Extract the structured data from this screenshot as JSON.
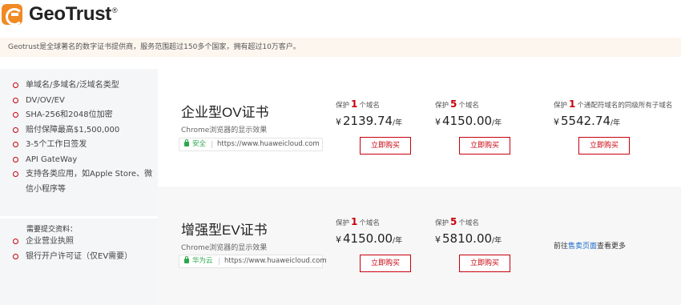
{
  "brand": {
    "name": "GeoTrust",
    "reg": "®"
  },
  "banner": "Geotrust是全球著名的数字证书提供商，服务范围超过150多个国家，拥有超过10万客户。",
  "features": [
    "单域名/多域名/泛域名类型",
    "DV/OV/EV",
    "SHA-256和2048位加密",
    "赔付保障最高$1,500,000",
    "3-5个工作日签发",
    "API GateWay",
    "支持各类应用，如Apple Store、微信小程序等"
  ],
  "requirements": {
    "title": "需要提交资料：",
    "items": [
      "企业营业执照",
      "银行开户许可证（仅EV需要）"
    ]
  },
  "ov": {
    "title": "企业型OV证书",
    "browser_label": "Chrome浏览器的显示效果",
    "badge": "安全",
    "url": "https://www.huaweicloud.com",
    "options": [
      {
        "prefix": "保护",
        "count": "1",
        "suffix": "个域名",
        "currency": "¥",
        "price": "2139.74",
        "unit": "/年",
        "button": "立即购买"
      },
      {
        "prefix": "保护",
        "count": "5",
        "suffix": "个域名",
        "currency": "¥",
        "price": "4150.00",
        "unit": "/年",
        "button": "立即购买"
      },
      {
        "prefix": "保护",
        "count": "1",
        "suffix": "个通配符域名的同级所有子域名",
        "currency": "¥",
        "price": "5542.74",
        "unit": "/年",
        "button": "立即购买"
      }
    ]
  },
  "ev": {
    "title": "增强型EV证书",
    "browser_label": "Chrome浏览器的显示效果",
    "badge": "华为云",
    "url": "https://www.huaweicloud.com",
    "options": [
      {
        "prefix": "保护",
        "count": "1",
        "suffix": "个域名",
        "currency": "¥",
        "price": "4150.00",
        "unit": "/年",
        "button": "立即购买"
      },
      {
        "prefix": "保护",
        "count": "5",
        "suffix": "个域名",
        "currency": "¥",
        "price": "5810.00",
        "unit": "/年",
        "button": "立即购买"
      }
    ],
    "more": {
      "prefix": "前往",
      "link": "售卖页面",
      "suffix": "查看更多"
    }
  },
  "colors": {
    "accent": "#c7000b",
    "secure": "#2ba84a",
    "link": "#1a6ac8",
    "banner_bg": "#fdf6ef",
    "panel_bg": "#f5f6f8"
  }
}
